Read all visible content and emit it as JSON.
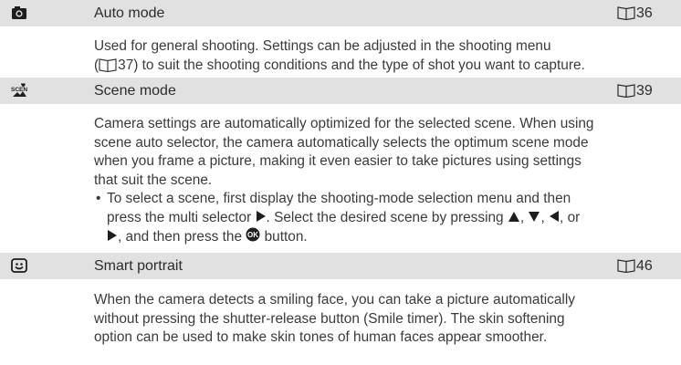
{
  "sections": [
    {
      "icon": "camera-icon",
      "title": "Auto mode",
      "ref_page": "36",
      "paragraph_lines": [
        "Used for general shooting. Settings can be adjusted in the shooting menu",
        "37) to suit the shooting conditions and the type of shot you want to capture."
      ],
      "inline_ref_prefix": "(",
      "inline_ref_page": ""
    },
    {
      "icon": "scene-icon",
      "title": "Scene mode",
      "ref_page": "39",
      "paragraph_lines": [
        "Camera settings are automatically optimized for the selected scene. When using",
        "scene auto selector, the camera automatically selects the optimum scene mode",
        "when you frame a picture, making it even easier to take pictures using settings",
        "that suit the scene."
      ],
      "bullet": {
        "symbol": "•",
        "line1": "To select a scene, first display the shooting-mode selection menu and then",
        "line2_a": "press the multi selector",
        "line2_b": ". Select the desired scene by pressing",
        "sep1": ",",
        "sep2": ",",
        "sep3": ", or",
        "line3_b": ", and then press the",
        "line3_c": "button."
      }
    },
    {
      "icon": "smile-icon",
      "title": "Smart portrait",
      "ref_page": "46",
      "paragraph_lines": [
        "When the camera detects a smiling face, you can take a picture automatically",
        "without pressing the shutter-release button (Smile timer). The skin softening",
        "option can be used to make skin tones of human faces appear smoother."
      ]
    }
  ]
}
